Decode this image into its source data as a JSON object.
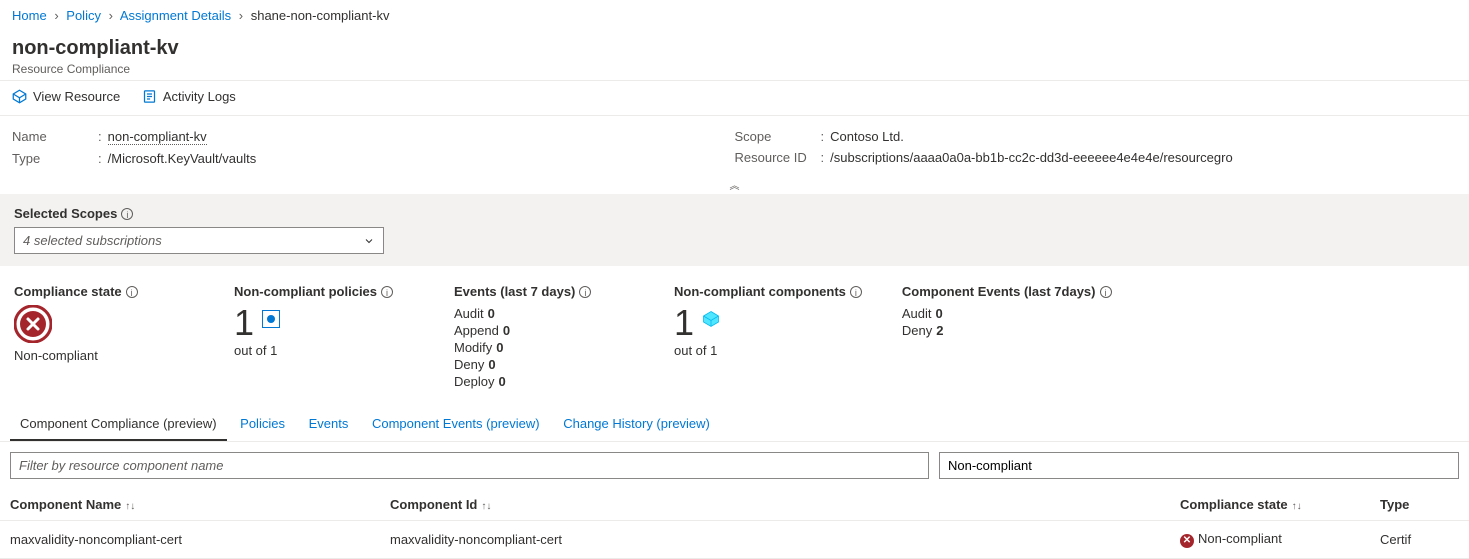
{
  "breadcrumb": {
    "items": [
      "Home",
      "Policy",
      "Assignment Details"
    ],
    "current": "shane-non-compliant-kv"
  },
  "header": {
    "title": "non-compliant-kv",
    "subtitle": "Resource Compliance"
  },
  "toolbar": {
    "view_resource": "View Resource",
    "activity_logs": "Activity Logs"
  },
  "props_left": {
    "name_label": "Name",
    "name_value": "non-compliant-kv",
    "type_label": "Type",
    "type_value": "/Microsoft.KeyVault/vaults"
  },
  "props_right": {
    "scope_label": "Scope",
    "scope_value": "Contoso Ltd.",
    "resid_label": "Resource ID",
    "resid_value": "/subscriptions/aaaa0a0a-bb1b-cc2c-dd3d-eeeeee4e4e4e/resourcegro"
  },
  "scopes": {
    "label": "Selected Scopes",
    "selected": "4 selected subscriptions"
  },
  "stats": {
    "compliance_state": {
      "title": "Compliance state",
      "value": "Non-compliant"
    },
    "noncompliant_policies": {
      "title": "Non-compliant policies",
      "num": "1",
      "sub": "out of 1"
    },
    "events": {
      "title": "Events (last 7 days)",
      "rows": [
        {
          "label": "Audit",
          "value": "0"
        },
        {
          "label": "Append",
          "value": "0"
        },
        {
          "label": "Modify",
          "value": "0"
        },
        {
          "label": "Deny",
          "value": "0"
        },
        {
          "label": "Deploy",
          "value": "0"
        }
      ]
    },
    "noncompliant_components": {
      "title": "Non-compliant components",
      "num": "1",
      "sub": "out of 1"
    },
    "component_events": {
      "title": "Component Events (last 7days)",
      "rows": [
        {
          "label": "Audit",
          "value": "0"
        },
        {
          "label": "Deny",
          "value": "2"
        }
      ]
    }
  },
  "tabs": [
    {
      "label": "Component Compliance (preview)",
      "active": true
    },
    {
      "label": "Policies",
      "active": false
    },
    {
      "label": "Events",
      "active": false
    },
    {
      "label": "Component Events (preview)",
      "active": false
    },
    {
      "label": "Change History (preview)",
      "active": false
    }
  ],
  "filter": {
    "placeholder": "Filter by resource component name",
    "dropdown_value": "Non-compliant"
  },
  "table": {
    "headers": {
      "name": "Component Name",
      "id": "Component Id",
      "compliance": "Compliance state",
      "type": "Type"
    },
    "rows": [
      {
        "name": "maxvalidity-noncompliant-cert",
        "id": "maxvalidity-noncompliant-cert",
        "compliance": "Non-compliant",
        "type": "Certif"
      }
    ]
  }
}
